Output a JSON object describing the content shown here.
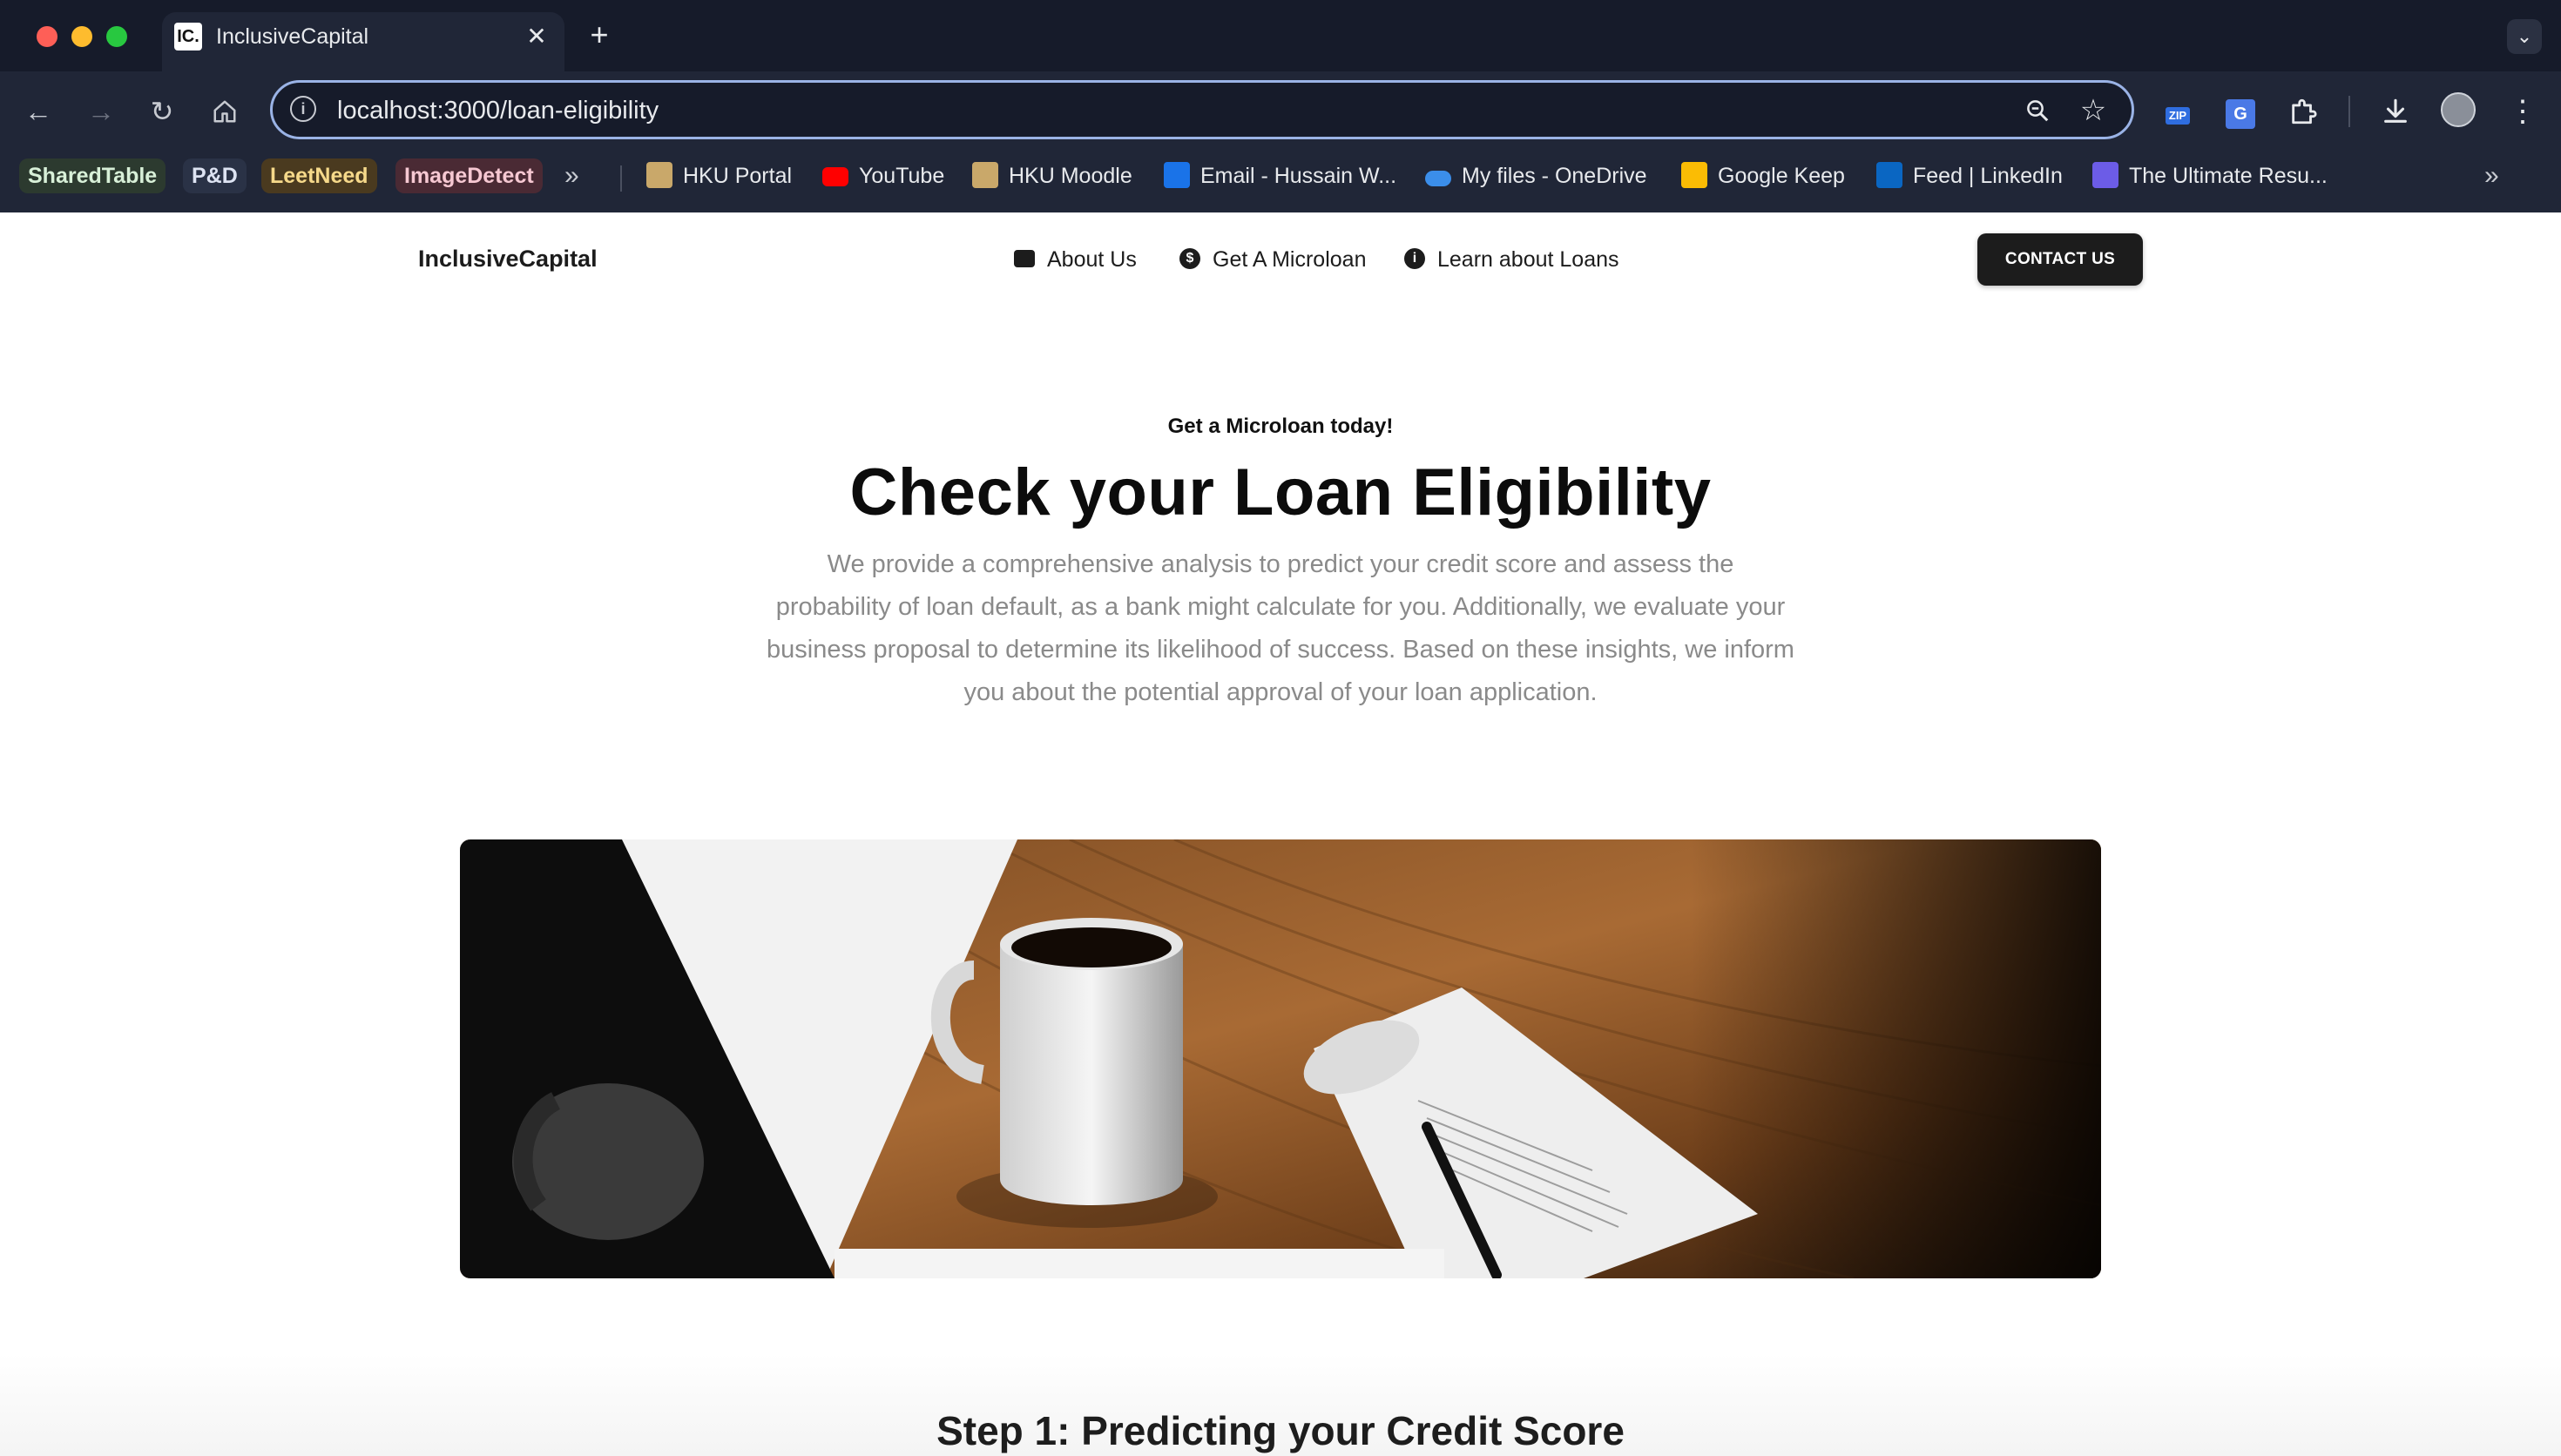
{
  "browser": {
    "tab_title": "InclusiveCapital",
    "tab_favicon": "IC.",
    "url": "localhost:3000/loan-eligibility",
    "icons": [
      "back-icon",
      "forward-icon",
      "reload-icon",
      "home-icon",
      "site-info-icon",
      "zoom-icon",
      "star-icon",
      "zip-extension-icon",
      "translate-extension-icon",
      "puzzle-icon",
      "download-icon",
      "avatar",
      "menu-icon"
    ],
    "zip_label": "ZIP",
    "bookmarks": [
      {
        "label": "SharedTable"
      },
      {
        "label": "P&D"
      },
      {
        "label": "LeetNeed"
      },
      {
        "label": "ImageDetect"
      },
      {
        "label": "HKU Portal",
        "color": "#c9a86a"
      },
      {
        "label": "YouTube",
        "color": "#ff0000"
      },
      {
        "label": "HKU Moodle",
        "color": "#c9a86a"
      },
      {
        "label": "Email - Hussain W...",
        "color": "#1a73e8"
      },
      {
        "label": "My files - OneDrive",
        "color": "#3b8eea"
      },
      {
        "label": "Google Keep",
        "color": "#fbbc04"
      },
      {
        "label": "Feed | LinkedIn",
        "color": "#0a66c2"
      },
      {
        "label": "The Ultimate Resu...",
        "color": "#6c5ce7"
      }
    ]
  },
  "site": {
    "brand": "InclusiveCapital",
    "nav": [
      {
        "label": "About Us",
        "icon": "briefcase-icon"
      },
      {
        "label": "Get A Microloan",
        "icon": "dollar-icon"
      },
      {
        "label": "Learn about Loans",
        "icon": "info-icon"
      }
    ],
    "contact_label": "CONTACT US"
  },
  "hero": {
    "kicker": "Get a Microloan today!",
    "title": "Check your Loan Eligibility",
    "description": "We provide a comprehensive analysis to predict your credit score and assess the probability of loan default, as a bank might calculate for you. Additionally, we evaluate your business proposal to determine its likelihood of success. Based on these insights, we inform you about the potential approval of your loan application.",
    "image": "photo of coffee mug and notepad with pen on wooden desk"
  },
  "step1": {
    "title": "Step 1: Predicting your Credit Score"
  },
  "colors": {
    "chrome_bg": "#202637",
    "tabstrip_bg": "#161b2a",
    "button_dark": "#1c1c1c",
    "text_muted": "#8a8a8a"
  }
}
